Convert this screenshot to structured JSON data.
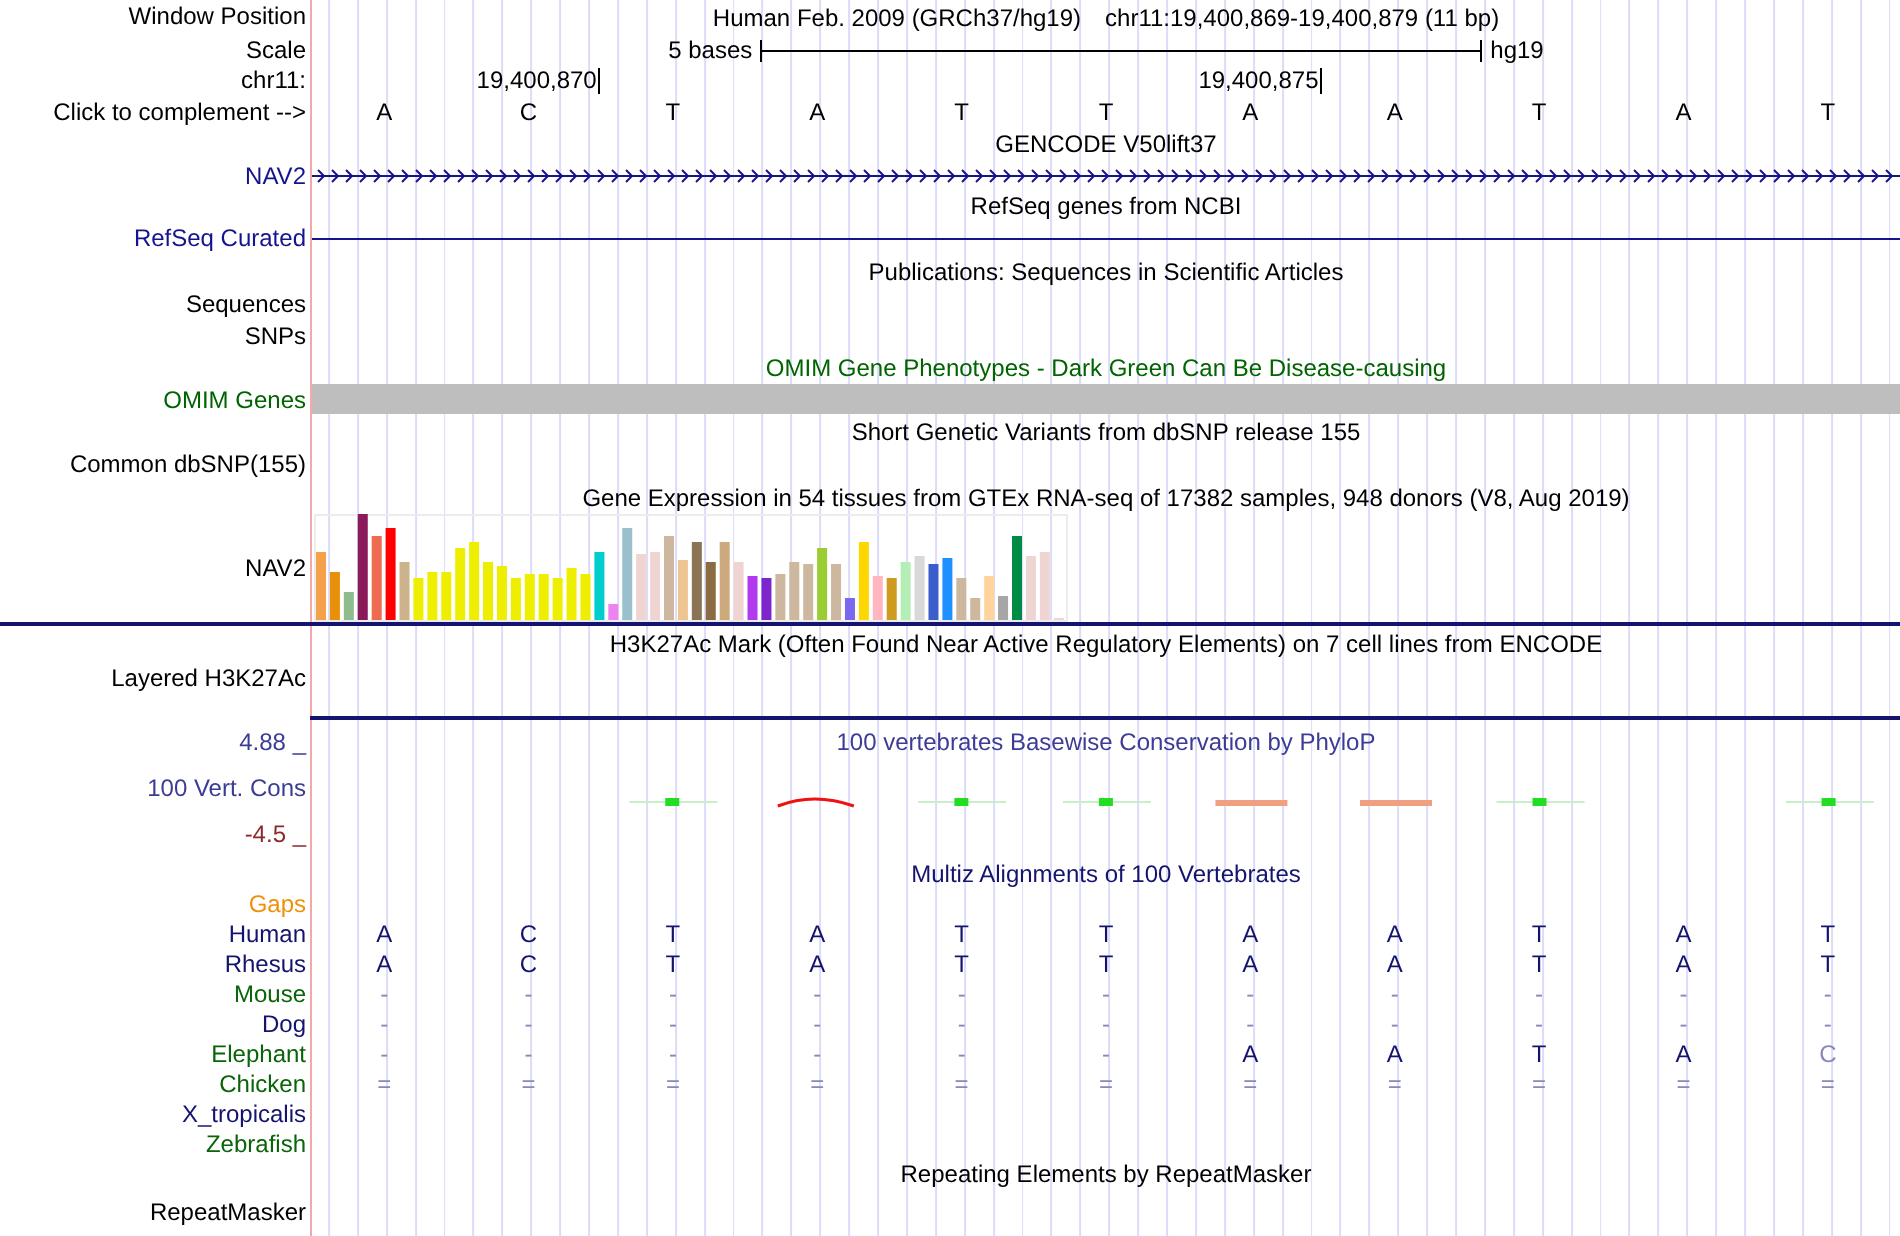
{
  "header": {
    "window_label": "Window Position",
    "assembly": "Human Feb. 2009 (GRCh37/hg19)",
    "position": "chr11:19,400,869-19,400,879 (11 bp)",
    "scale_label": "Scale",
    "scale_span": "5 bases",
    "scale_db": "hg19",
    "chrom_label": "chr11:",
    "ticks": [
      "19,400,870",
      "19,400,875"
    ],
    "complement_label": "Click to complement -->",
    "bases": [
      "A",
      "C",
      "T",
      "A",
      "T",
      "T",
      "A",
      "A",
      "T",
      "A",
      "T"
    ]
  },
  "tracks": [
    {
      "kind": "gene",
      "title": {
        "text": "GENCODE V50lift37",
        "color": "#000000"
      },
      "labels": [
        {
          "text": "NAV2",
          "color": "#14148c"
        }
      ]
    },
    {
      "kind": "line",
      "title": {
        "text": "RefSeq genes from NCBI",
        "color": "#000000"
      },
      "labels": [
        {
          "text": "RefSeq Curated",
          "color": "#14148c"
        }
      ]
    },
    {
      "kind": "empty",
      "title": {
        "text": "Publications: Sequences in Scientific Articles",
        "color": "#000000"
      },
      "labels": [
        {
          "text": "Sequences",
          "color": "#000000"
        },
        {
          "text": "SNPs",
          "color": "#000000"
        }
      ]
    },
    {
      "kind": "bar",
      "title": {
        "text": "OMIM Gene Phenotypes - Dark Green Can Be Disease-causing",
        "color": "#006400"
      },
      "labels": [
        {
          "text": "OMIM Genes",
          "color": "#006400"
        }
      ]
    },
    {
      "kind": "empty",
      "title": {
        "text": "Short Genetic Variants from dbSNP release 155",
        "color": "#000000"
      },
      "labels": [
        {
          "text": "Common dbSNP(155)",
          "color": "#000000"
        }
      ]
    },
    {
      "kind": "expression",
      "title": {
        "text": "Gene Expression in 54 tissues from GTEx RNA-seq of 17382 samples, 948 donors (V8, Aug 2019)",
        "color": "#000000"
      },
      "labels": [
        {
          "text": "NAV2",
          "color": "#000000"
        }
      ]
    },
    {
      "kind": "signal",
      "title": {
        "text": "H3K27Ac Mark (Often Found Near Active Regulatory Elements) on 7 cell lines from ENCODE",
        "color": "#000000"
      },
      "labels": [
        {
          "text": "Layered H3K27Ac",
          "color": "#000000"
        }
      ]
    },
    {
      "kind": "conservation",
      "title": {
        "text": "100 vertebrates Basewise Conservation by PhyloP",
        "color": "#3c3c96"
      },
      "labels": [
        {
          "text": "100 Vert. Cons",
          "color": "#3c3c96"
        }
      ],
      "ymax": "4.88 _",
      "ymin": "-4.5 _"
    },
    {
      "kind": "alignment",
      "title": {
        "text": "Multiz Alignments of 100 Vertebrates",
        "color": "#14146e"
      },
      "species": [
        {
          "name": "Gaps",
          "color": "#f0900a"
        },
        {
          "name": "Human",
          "color": "#14146e",
          "bases": [
            "A",
            "C",
            "T",
            "A",
            "T",
            "T",
            "A",
            "A",
            "T",
            "A",
            "T"
          ]
        },
        {
          "name": "Rhesus",
          "color": "#14146e",
          "bases": [
            "A",
            "C",
            "T",
            "A",
            "T",
            "T",
            "A",
            "A",
            "T",
            "A",
            "T"
          ]
        },
        {
          "name": "Mouse",
          "color": "#0a640a",
          "bases": [
            "-",
            "-",
            "-",
            "-",
            "-",
            "-",
            "-",
            "-",
            "-",
            "-",
            "-"
          ]
        },
        {
          "name": "Dog",
          "color": "#14146e",
          "bases": [
            "-",
            "-",
            "-",
            "-",
            "-",
            "-",
            "-",
            "-",
            "-",
            "-",
            "-"
          ]
        },
        {
          "name": "Elephant",
          "color": "#0a640a",
          "bases": [
            "-",
            "-",
            "-",
            "-",
            "-",
            "-",
            "A",
            "A",
            "T",
            "A",
            "C"
          ]
        },
        {
          "name": "Chicken",
          "color": "#0a640a",
          "bases": [
            "=",
            "=",
            "=",
            "=",
            "=",
            "=",
            "=",
            "=",
            "=",
            "=",
            "="
          ]
        },
        {
          "name": "X_tropicalis",
          "color": "#14146e"
        },
        {
          "name": "Zebrafish",
          "color": "#0a640a"
        }
      ]
    },
    {
      "kind": "empty",
      "title": {
        "text": "Repeating Elements by RepeatMasker",
        "color": "#000000"
      },
      "labels": [
        {
          "text": "RepeatMasker",
          "color": "#000000"
        }
      ]
    }
  ]
}
